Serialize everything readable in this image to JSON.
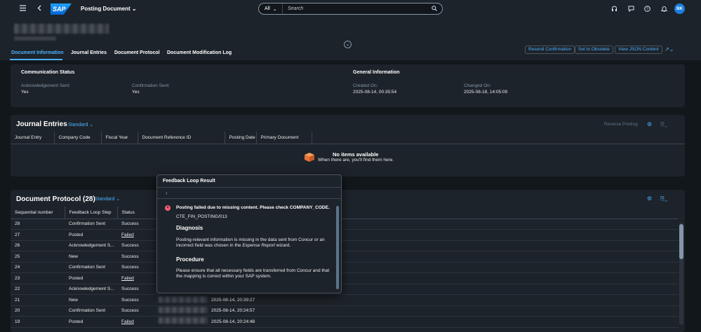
{
  "shell": {
    "logo_text": "SAP",
    "app_title": "Posting Document",
    "search_scope": "All",
    "search_placeholder": "Search",
    "user_initials": "BK"
  },
  "header": {
    "actions": [
      "Resend Confirmation",
      "Set to Obsolete",
      "View JSON Content"
    ],
    "tabs": [
      "Document Information",
      "Journal Entries",
      "Document Protocol",
      "Document Modification Log"
    ]
  },
  "document_info": {
    "communication_status": {
      "title": "Communication Status",
      "ack_label": "Acknowledgement Sent:",
      "ack_value": "Yes",
      "conf_label": "Confirmation Sent:",
      "conf_value": "Yes"
    },
    "general_information": {
      "title": "General Information",
      "created_label": "Created On:",
      "created_value": "2025-08-14, 00:35:54",
      "changed_label": "Changed On:",
      "changed_value": "2025-08-18, 14:05:09"
    }
  },
  "journal_entries": {
    "title": "Journal Entries",
    "variant": "Standard",
    "reverse_action": "Reverse Posting",
    "columns": [
      "Journal Entry",
      "Company Code",
      "Fiscal Year",
      "Document Reference ID",
      "Posting Date",
      "Primary Document"
    ],
    "empty_title": "No items available",
    "empty_text": "When there are, you'll find them here."
  },
  "document_protocol": {
    "title": "Document Protocol (28)",
    "variant": "Standard",
    "columns": [
      "Sequential number",
      "Feedback Loop Step",
      "Status"
    ],
    "rows": [
      {
        "seq": "28",
        "step": "Confirmation Sent",
        "status": "Success",
        "time": ""
      },
      {
        "seq": "27",
        "step": "Posted",
        "status": "Failed",
        "time": ""
      },
      {
        "seq": "26",
        "step": "Acknowledgement S...",
        "status": "Success",
        "time": ""
      },
      {
        "seq": "25",
        "step": "New",
        "status": "Success",
        "time": ""
      },
      {
        "seq": "24",
        "step": "Confirmation Sent",
        "status": "Success",
        "time": ""
      },
      {
        "seq": "23",
        "step": "Posted",
        "status": "Failed",
        "time": ""
      },
      {
        "seq": "22",
        "step": "Acknowledgement S...",
        "status": "Success",
        "time": ""
      },
      {
        "seq": "21",
        "step": "New",
        "status": "Success",
        "time": "2025-08-14, 20:39:27"
      },
      {
        "seq": "20",
        "step": "Confirmation Sent",
        "status": "Success",
        "time": "2025-08-14, 20:24:57"
      },
      {
        "seq": "19",
        "step": "Posted",
        "status": "Failed",
        "time": "2025-08-14, 20:24:48"
      }
    ]
  },
  "popover": {
    "title": "Feedback Loop Result",
    "message": "Posting failed due to missing content. Please check COMPANY_CODE.",
    "code": "CTE_FIN_POSTING/013",
    "diagnosis_title": "Diagnosis",
    "diagnosis_text_1": "Posting-relevant information is missing in the data sent from Concur or an incorrect field was chosen in the",
    "diagnosis_emphasis": "Expense Report",
    "diagnosis_text_2": "wizard.",
    "procedure_title": "Procedure",
    "procedure_text": "Please ensure that all necessary fields are transferred from Concur and that the mapping is correct within your SAP system."
  },
  "colors": {
    "success": "#5dc122",
    "failed": "#ff5c77",
    "accent": "#4db1ff",
    "background": "#12171c",
    "surface": "#1d232a"
  }
}
